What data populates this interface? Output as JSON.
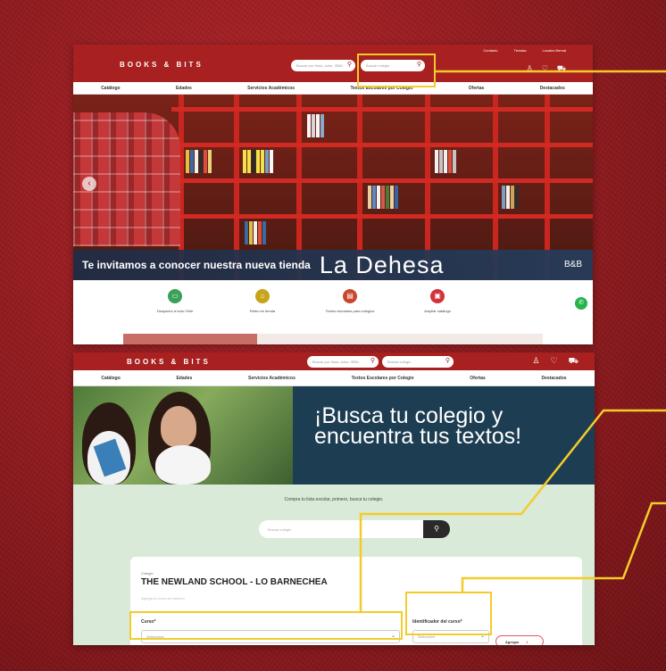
{
  "shot1": {
    "logo": "BOOKS & BITS",
    "search_text": "Buscar por título, autor, ISBN",
    "school_search_text": "Buscar colegio",
    "top_links": [
      "Contacto",
      "Tiendas",
      "Locales Bernal"
    ],
    "nav": [
      "Catálogo",
      "Edades",
      "Servicios Académicos",
      "Textos Escolares por Colegio",
      "Ofertas",
      "Destacados"
    ],
    "banner_lead": "Te invitamos a conocer nuestra nueva tienda",
    "banner_place": "La Dehesa",
    "banner_brand": "B&B",
    "features": [
      {
        "label": "Despacho a todo Chile",
        "color": "#3aa05a"
      },
      {
        "label": "Retiro en tienda",
        "color": "#c7a418"
      },
      {
        "label": "Textos escolares para colegios",
        "color": "#c9472d"
      },
      {
        "label": "Ampliar catálogo",
        "color": "#d2333a"
      }
    ]
  },
  "shot2": {
    "logo": "BOOKS & BITS",
    "search_text": "Buscar por título, autor, ISBN",
    "school_search_text": "Buscar colegio",
    "nav": [
      "Catálogo",
      "Edades",
      "Servicios Académicos",
      "Textos Escolares por Colegio",
      "Ofertas",
      "Destacados"
    ],
    "hero_line1": "¡Busca tu colegio y",
    "hero_line2": "encuentra tus textos!",
    "prompt": "Compra tu lista escolar, primero, busca tu colegio.",
    "search_placeholder": "Buscar colegio",
    "card": {
      "label": "Colegio",
      "school": "THE NEWLAND SCHOOL - LO BARNECHEA",
      "hint": "Agrega el curso del alumno",
      "course_label": "Curso*",
      "course_value": "Seleccione",
      "id_label": "Identificador del curso*",
      "id_value": "Seleccione",
      "add_label": "Agregar",
      "add_count": "1"
    }
  }
}
